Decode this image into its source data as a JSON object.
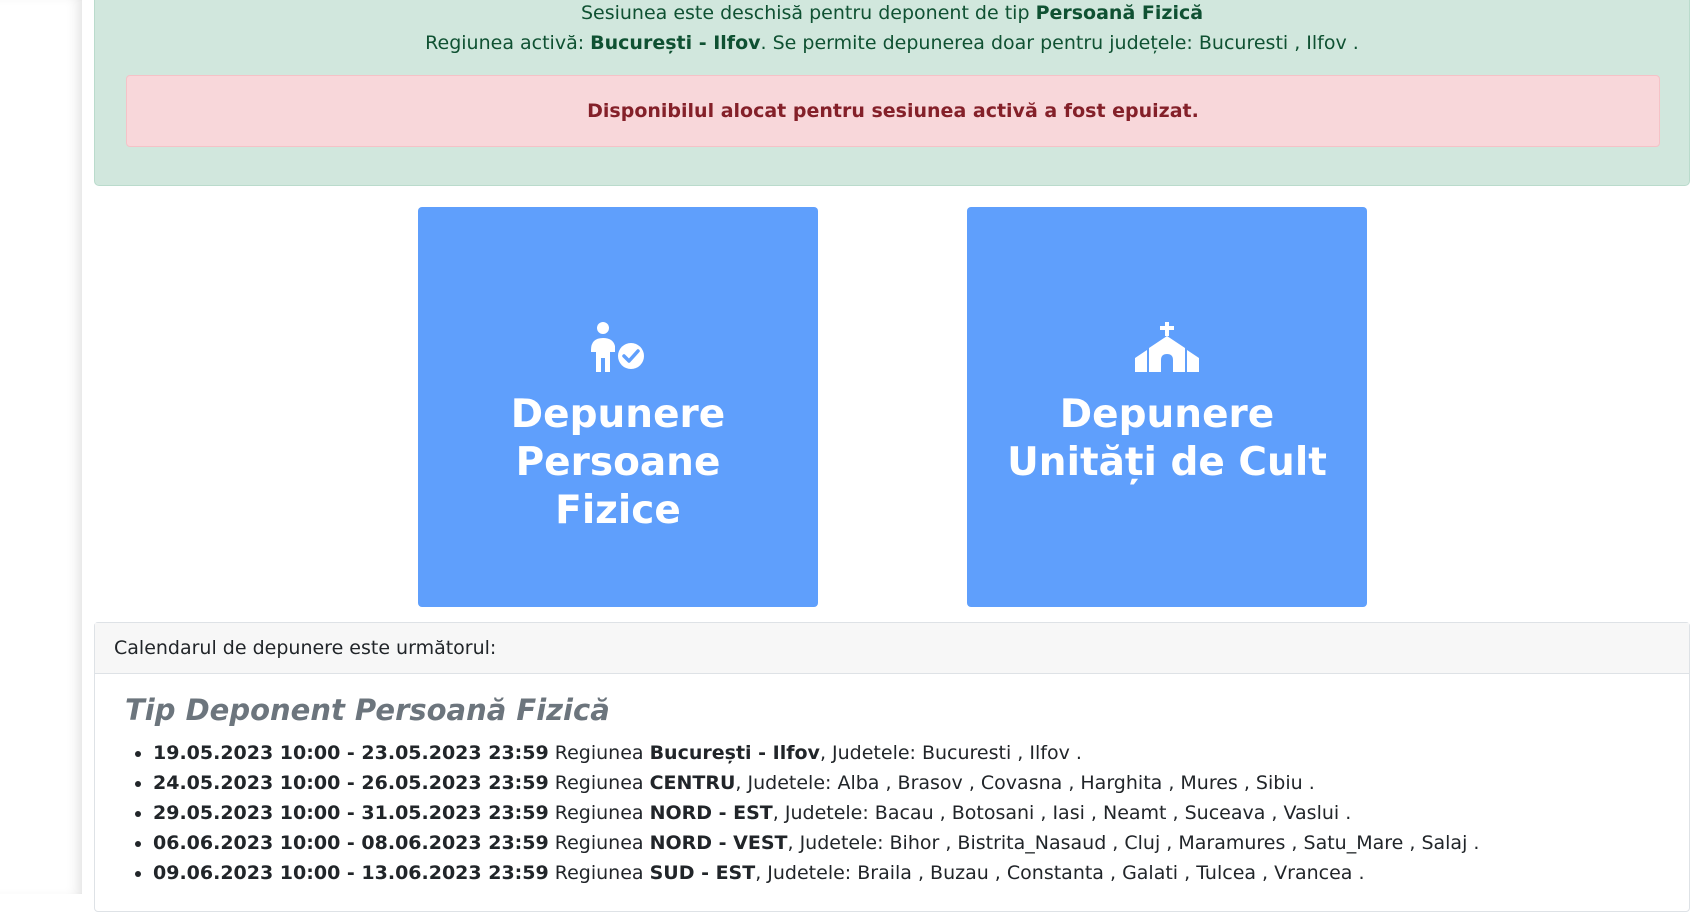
{
  "session": {
    "line1_prefix": "Sesiunea este deschisă pentru deponent de tip ",
    "deponent_type": "Persoană Fizică",
    "line2_prefix": "Regiunea activă: ",
    "active_region": "București - Ilfov",
    "line2_middle": ". Se permite depunerea doar pentru județele: ",
    "allowed_counties": "Bucuresti , Ilfov ."
  },
  "alert": {
    "message": "Disponibilul alocat pentru sesiunea activă a fost epuizat."
  },
  "tiles": [
    {
      "label": "Depunere Persoane Fizice",
      "icon": "person-check-icon"
    },
    {
      "label": "Depunere Unități de Cult",
      "icon": "church-icon"
    }
  ],
  "calendar": {
    "header": "Calendarul de depunere este următorul:",
    "title": "Tip Deponent Persoană Fizică",
    "schedule": [
      {
        "period": "19.05.2023 10:00 - 23.05.2023 23:59",
        "region_word": " Regiunea ",
        "region": "București - Ilfov",
        "counties": ", Judetele: Bucuresti , Ilfov ."
      },
      {
        "period": "24.05.2023 10:00 - 26.05.2023 23:59",
        "region_word": " Regiunea ",
        "region": "CENTRU",
        "counties": ", Judetele: Alba , Brasov , Covasna , Harghita , Mures , Sibiu ."
      },
      {
        "period": "29.05.2023 10:00 - 31.05.2023 23:59",
        "region_word": " Regiunea ",
        "region": "NORD - EST",
        "counties": ", Judetele: Bacau , Botosani , Iasi , Neamt , Suceava , Vaslui ."
      },
      {
        "period": "06.06.2023 10:00 - 08.06.2023 23:59",
        "region_word": " Regiunea ",
        "region": "NORD - VEST",
        "counties": ", Judetele: Bihor , Bistrita_Nasaud , Cluj , Maramures , Satu_Mare , Salaj ."
      },
      {
        "period": "09.06.2023 10:00 - 13.06.2023 23:59",
        "region_word": " Regiunea ",
        "region": "SUD - EST",
        "counties": ", Judetele: Braila , Buzau , Constanta , Galati , Tulcea , Vrancea ."
      }
    ]
  }
}
